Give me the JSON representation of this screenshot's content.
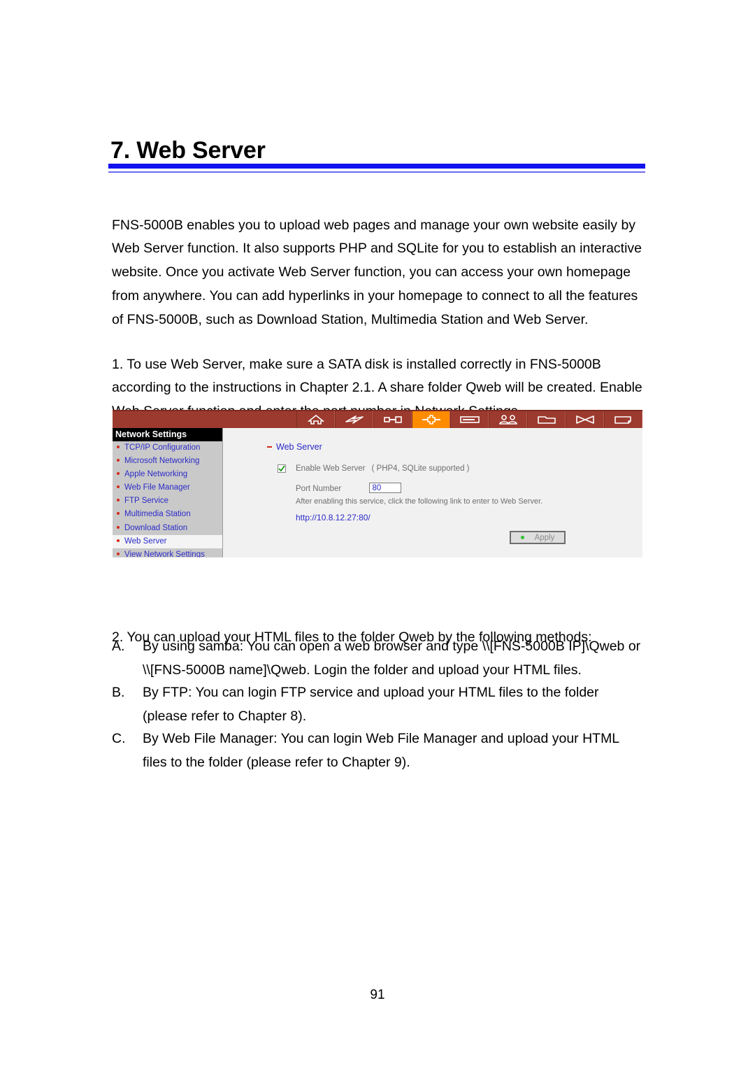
{
  "document": {
    "chapter_title": "7. Web Server",
    "page_number": "91",
    "rule_color": "#1212ef"
  },
  "paragraphs": {
    "intro": "FNS-5000B enables you to upload web pages and manage your own website easily by Web Server function.  It also supports PHP and SQLite for you to establish an interactive website.  Once you activate Web Server function, you can access your own homepage from anywhere.  You can add hyperlinks in your homepage to connect to all the features of FNS-5000B, such as Download Station, Multimedia Station and Web Server.",
    "step1": "1. To use Web Server, make sure a SATA disk is installed correctly in FNS-5000B according to the instructions in Chapter 2.1.  A share folder Qweb will be created.  Enable Web Server function and enter the port number in Network Settings.",
    "step2": "2. You can upload your HTML files to the folder Qweb by the following methods:"
  },
  "lettered_items": [
    {
      "marker": "A.",
      "text": "By using samba: You can open a web browser and type \\\\[FNS-5000B IP]\\Qweb or \\\\[FNS-5000B name]\\Qweb.  Login the folder and upload your HTML files."
    },
    {
      "marker": "B.",
      "text": "By FTP: You can login FTP service and upload your HTML files to the folder (please refer to Chapter 8)."
    },
    {
      "marker": "C.",
      "text": "By Web File Manager: You can login Web File Manager and upload your HTML files to the folder (please refer to Chapter 9)."
    }
  ],
  "screenshot": {
    "toolbar": {
      "background_color": "#9c3a2f",
      "active_color": "#ff8c00",
      "icons": [
        {
          "name": "home-icon",
          "active": false
        },
        {
          "name": "lightning-bolt-icon",
          "active": false
        },
        {
          "name": "key-icon",
          "active": false
        },
        {
          "name": "network-plug-icon",
          "active": true
        },
        {
          "name": "disk-drive-icon",
          "active": false
        },
        {
          "name": "users-icon",
          "active": false
        },
        {
          "name": "folder-icon",
          "active": false
        },
        {
          "name": "network-share-icon",
          "active": false
        },
        {
          "name": "document-icon",
          "active": false
        }
      ]
    },
    "sidebar": {
      "header": "Network Settings",
      "items": [
        {
          "label": "TCP/IP Configuration",
          "selected": false
        },
        {
          "label": "Microsoft Networking",
          "selected": false
        },
        {
          "label": "Apple Networking",
          "selected": false
        },
        {
          "label": "Web File Manager",
          "selected": false
        },
        {
          "label": "FTP Service",
          "selected": false
        },
        {
          "label": "Multimedia Station",
          "selected": false
        },
        {
          "label": "Download Station",
          "selected": false
        },
        {
          "label": "Web Server",
          "selected": true
        },
        {
          "label": "View Network Settings",
          "selected": false
        }
      ]
    },
    "panel": {
      "section_title": "Web Server",
      "enable_label": "Enable Web Server",
      "enable_note": "( PHP4, SQLite supported )",
      "enable_checked": true,
      "port_label": "Port Number",
      "port_value": "80",
      "hint": "After enabling this service, click the following link to enter to Web Server.",
      "link": "http://10.8.12.27:80/",
      "apply_label": "Apply"
    }
  }
}
